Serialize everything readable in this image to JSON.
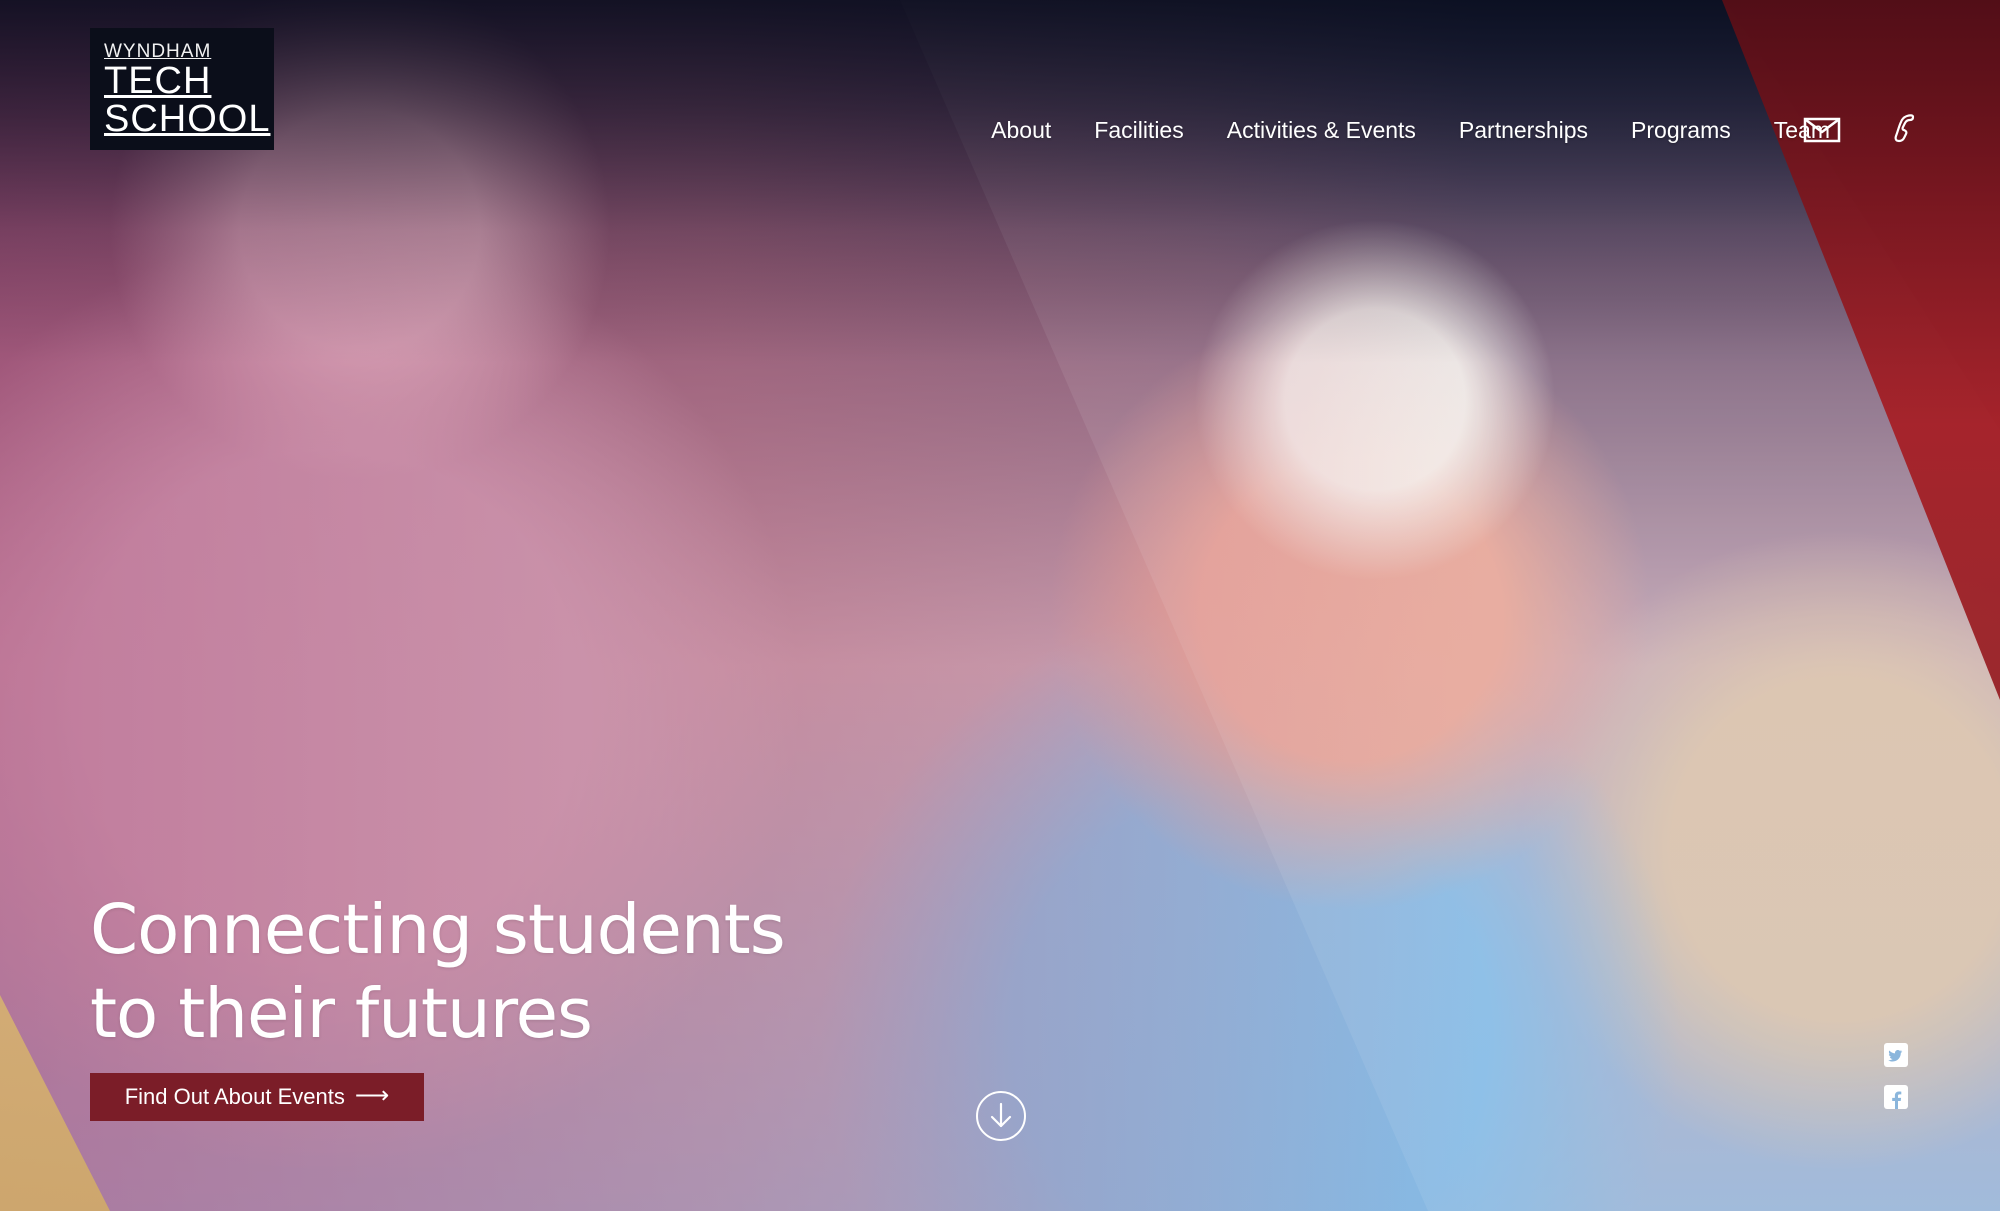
{
  "brand": {
    "line1": "WYNDHAM",
    "line2": "TECH",
    "line3": "SCHOOL"
  },
  "nav": {
    "items": [
      {
        "label": "About"
      },
      {
        "label": "Facilities"
      },
      {
        "label": "Activities & Events"
      },
      {
        "label": "Partnerships"
      },
      {
        "label": "Programs"
      },
      {
        "label": "Team"
      }
    ],
    "icons": {
      "mail": "mail-icon",
      "phone": "phone-icon"
    }
  },
  "hero": {
    "headline_line1": "Connecting students",
    "headline_line2": "to their futures",
    "cta_label": "Find Out About Events",
    "cta_arrow": "⟶"
  },
  "social": {
    "twitter_icon": "twitter-icon",
    "facebook_icon": "facebook-icon"
  },
  "colors": {
    "accent": "#7b1d28",
    "red_panel": "#a71a20",
    "yellow_panel": "#e0bd7b",
    "text": "#ffffff"
  }
}
